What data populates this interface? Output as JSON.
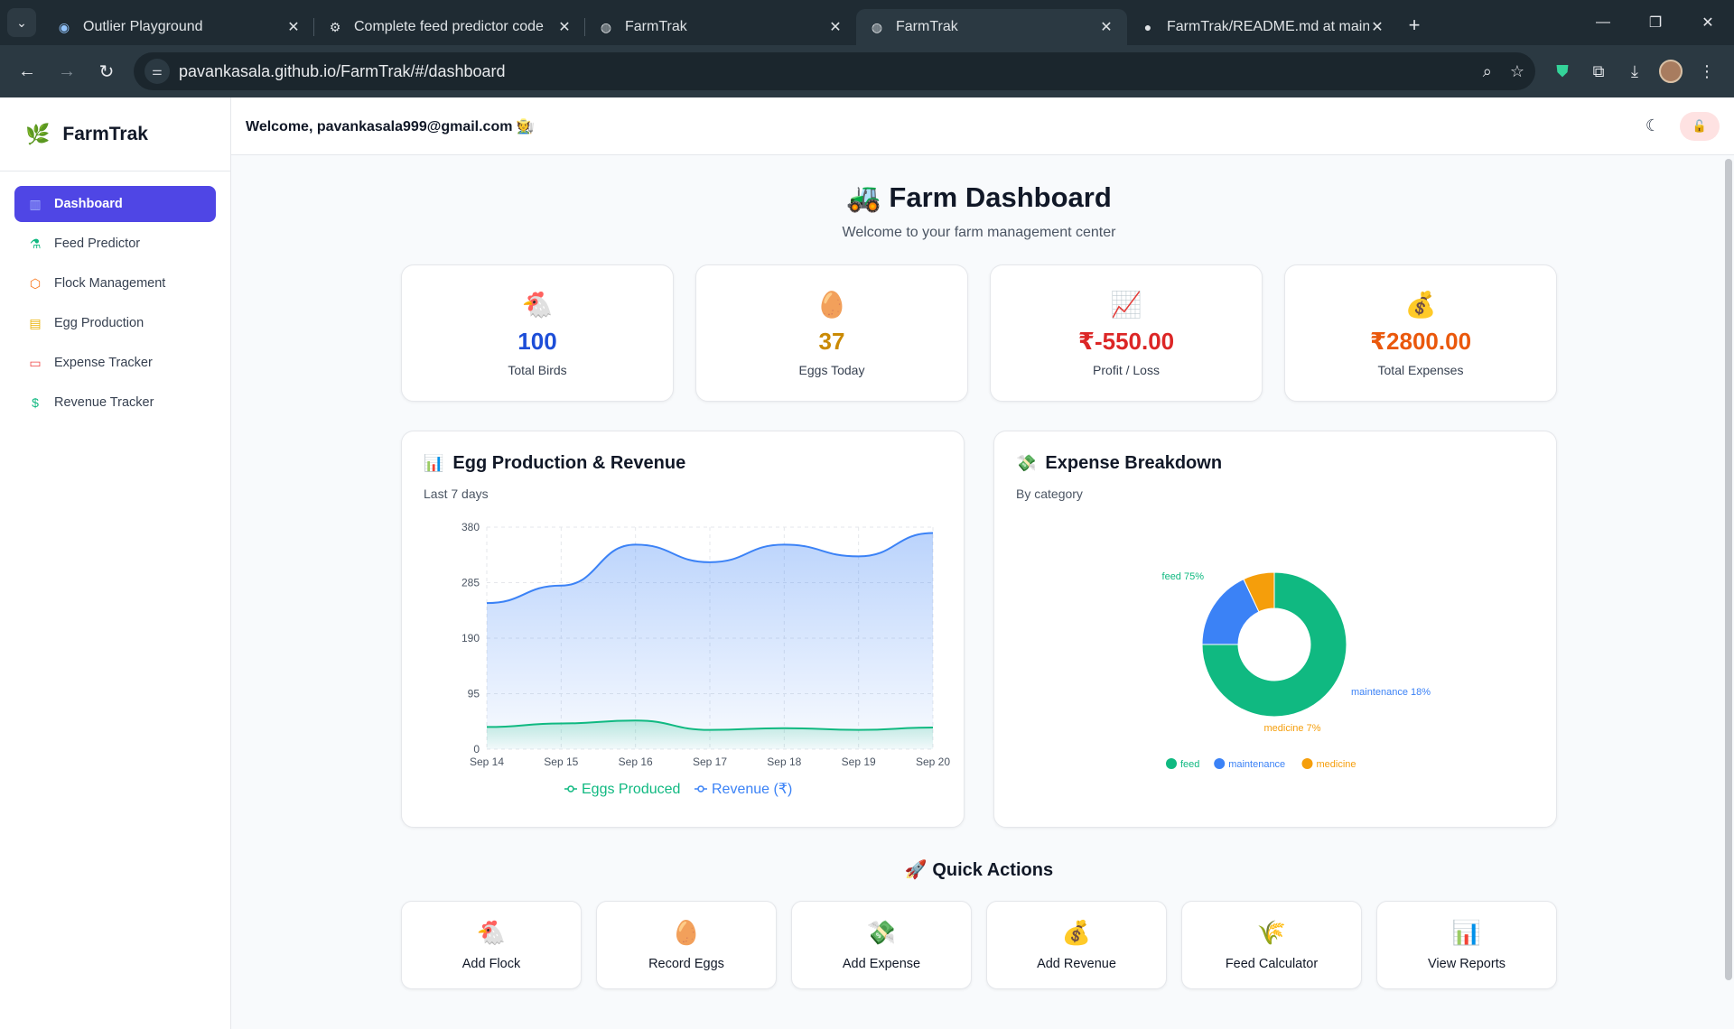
{
  "browser": {
    "tabs": [
      {
        "title": "Outlier Playground",
        "icon": "outlier-icon",
        "active": false
      },
      {
        "title": "Complete feed predictor code",
        "icon": "openai-icon",
        "active": false
      },
      {
        "title": "FarmTrak",
        "icon": "globe-icon",
        "active": false
      },
      {
        "title": "FarmTrak",
        "icon": "globe-icon",
        "active": true
      },
      {
        "title": "FarmTrak/README.md at main",
        "icon": "github-icon",
        "active": false
      }
    ],
    "url": "pavankasala.github.io/FarmTrak/#/dashboard"
  },
  "sidebar": {
    "brand": "FarmTrak",
    "items": [
      {
        "label": "Dashboard",
        "icon": "chart-bar-icon",
        "color": "#4f46e5",
        "active": true
      },
      {
        "label": "Feed Predictor",
        "icon": "flask-icon",
        "color": "#10b981",
        "active": false
      },
      {
        "label": "Flock Management",
        "icon": "box-icon",
        "color": "#f97316",
        "active": false
      },
      {
        "label": "Egg Production",
        "icon": "archive-icon",
        "color": "#eab308",
        "active": false
      },
      {
        "label": "Expense Tracker",
        "icon": "credit-card-icon",
        "color": "#ef4444",
        "active": false
      },
      {
        "label": "Revenue Tracker",
        "icon": "dollar-circle-icon",
        "color": "#10b981",
        "active": false
      }
    ]
  },
  "topbar": {
    "welcome": "Welcome, pavankasala999@gmail.com 🧑‍🌾"
  },
  "hero": {
    "title": "🚜 Farm Dashboard",
    "subtitle": "Welcome to your farm management center"
  },
  "stats": [
    {
      "icon": "🐔",
      "value": "100",
      "label": "Total Birds",
      "color": "#1d4ed8"
    },
    {
      "icon": "🥚",
      "value": "37",
      "label": "Eggs Today",
      "color": "#ca8a04"
    },
    {
      "icon": "📈",
      "value": "₹-550.00",
      "label": "Profit / Loss",
      "color": "#dc2626"
    },
    {
      "icon": "💰",
      "value": "₹2800.00",
      "label": "Total Expenses",
      "color": "#ea580c"
    }
  ],
  "line_card": {
    "icon": "📊",
    "title": "Egg Production & Revenue",
    "subtitle": "Last 7 days"
  },
  "pie_card": {
    "icon": "💸",
    "title": "Expense Breakdown",
    "subtitle": "By category"
  },
  "chart_data": [
    {
      "type": "area",
      "categories": [
        "Sep 14",
        "Sep 15",
        "Sep 16",
        "Sep 17",
        "Sep 18",
        "Sep 19",
        "Sep 20"
      ],
      "yticks": [
        0,
        95,
        190,
        285,
        380
      ],
      "ylim": [
        0,
        380
      ],
      "grid": true,
      "series": [
        {
          "name": "Eggs Produced",
          "values": [
            38,
            44,
            49,
            33,
            36,
            33,
            37
          ],
          "color": "#10b981"
        },
        {
          "name": "Revenue (₹)",
          "values": [
            250,
            280,
            350,
            320,
            350,
            330,
            370
          ],
          "color": "#3b82f6"
        }
      ],
      "legend": "bottom"
    },
    {
      "type": "pie",
      "donut": true,
      "slices": [
        {
          "name": "feed",
          "value": 75,
          "label": "feed 75%",
          "color": "#10b981"
        },
        {
          "name": "maintenance",
          "value": 18,
          "label": "maintenance 18%",
          "color": "#3b82f6"
        },
        {
          "name": "medicine",
          "value": 7,
          "label": "medicine 7%",
          "color": "#f59e0b"
        }
      ],
      "legend": "bottom"
    }
  ],
  "quick_actions": {
    "title": "🚀 Quick Actions",
    "items": [
      {
        "icon": "🐔",
        "label": "Add Flock"
      },
      {
        "icon": "🥚",
        "label": "Record Eggs"
      },
      {
        "icon": "💸",
        "label": "Add Expense"
      },
      {
        "icon": "💰",
        "label": "Add Revenue"
      },
      {
        "icon": "🌾",
        "label": "Feed Calculator"
      },
      {
        "icon": "📊",
        "label": "View Reports"
      }
    ]
  }
}
